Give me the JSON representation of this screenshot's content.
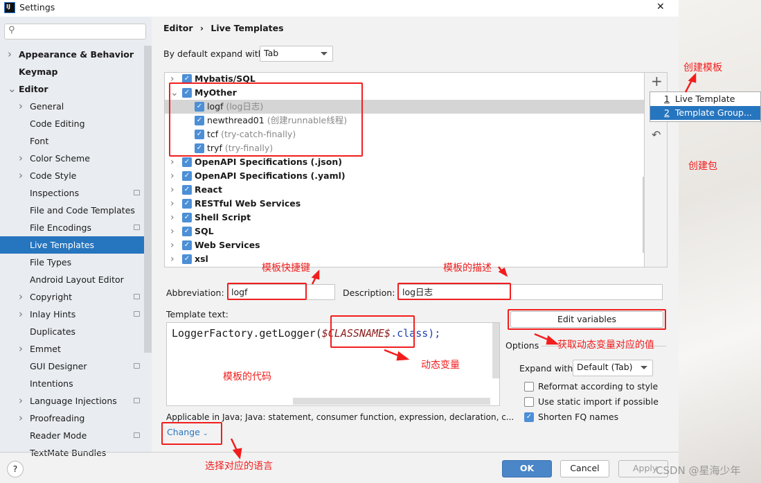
{
  "window": {
    "title": "Settings",
    "close": "✕"
  },
  "search": {
    "placeholder": ""
  },
  "sidebar": {
    "items": [
      {
        "label": "Appearance & Behavior",
        "level": 0,
        "bold": true,
        "chevron": "right"
      },
      {
        "label": "Keymap",
        "level": 0,
        "bold": true
      },
      {
        "label": "Editor",
        "level": 0,
        "bold": true,
        "chevron": "down"
      },
      {
        "label": "General",
        "level": 1,
        "chevron": "right"
      },
      {
        "label": "Code Editing",
        "level": 1
      },
      {
        "label": "Font",
        "level": 1
      },
      {
        "label": "Color Scheme",
        "level": 1,
        "chevron": "right"
      },
      {
        "label": "Code Style",
        "level": 1,
        "chevron": "right"
      },
      {
        "label": "Inspections",
        "level": 1,
        "cfg": true
      },
      {
        "label": "File and Code Templates",
        "level": 1
      },
      {
        "label": "File Encodings",
        "level": 1,
        "cfg": true
      },
      {
        "label": "Live Templates",
        "level": 1,
        "selected": true
      },
      {
        "label": "File Types",
        "level": 1
      },
      {
        "label": "Android Layout Editor",
        "level": 1
      },
      {
        "label": "Copyright",
        "level": 1,
        "chevron": "right",
        "cfg": true
      },
      {
        "label": "Inlay Hints",
        "level": 1,
        "chevron": "right",
        "cfg": true
      },
      {
        "label": "Duplicates",
        "level": 1
      },
      {
        "label": "Emmet",
        "level": 1,
        "chevron": "right"
      },
      {
        "label": "GUI Designer",
        "level": 1,
        "cfg": true
      },
      {
        "label": "Intentions",
        "level": 1
      },
      {
        "label": "Language Injections",
        "level": 1,
        "chevron": "right",
        "cfg": true
      },
      {
        "label": "Proofreading",
        "level": 1,
        "chevron": "right"
      },
      {
        "label": "Reader Mode",
        "level": 1,
        "cfg": true
      },
      {
        "label": "TextMate Bundles",
        "level": 1
      }
    ]
  },
  "breadcrumb": {
    "parent": "Editor",
    "sep": "›",
    "current": "Live Templates"
  },
  "expand_default": {
    "label": "By default expand with",
    "value": "Tab"
  },
  "tree": {
    "rows": [
      {
        "name": "Mybatis/SQL",
        "group": true,
        "chevron": "›"
      },
      {
        "name": "MyOther",
        "group": true,
        "chevron": "⌄"
      },
      {
        "name": "logf",
        "desc": "(log日志)",
        "selected": true
      },
      {
        "name": "newthread01",
        "desc": "(创建runnable线程)"
      },
      {
        "name": "tcf",
        "desc": "(try-catch-finally)"
      },
      {
        "name": "tryf",
        "desc": "(try-finally)"
      },
      {
        "name": "OpenAPI Specifications (.json)",
        "group": true,
        "chevron": "›"
      },
      {
        "name": "OpenAPI Specifications (.yaml)",
        "group": true,
        "chevron": "›"
      },
      {
        "name": "React",
        "group": true,
        "chevron": "›"
      },
      {
        "name": "RESTful Web Services",
        "group": true,
        "chevron": "›"
      },
      {
        "name": "Shell Script",
        "group": true,
        "chevron": "›"
      },
      {
        "name": "SQL",
        "group": true,
        "chevron": "›"
      },
      {
        "name": "Web Services",
        "group": true,
        "chevron": "›"
      },
      {
        "name": "xsl",
        "group": true,
        "chevron": "›"
      }
    ]
  },
  "toolbar": {
    "add": "+",
    "revert": "↶"
  },
  "popup": {
    "items": [
      {
        "num": "1",
        "label": "Live Template"
      },
      {
        "num": "2",
        "label": "Template Group...",
        "selected": true
      }
    ]
  },
  "abbreviation": {
    "label": "Abbreviation:",
    "value": "logf"
  },
  "description": {
    "label": "Description:",
    "value": "log日志"
  },
  "template": {
    "label": "Template text:",
    "code_prefix": "LoggerFactory.getLogger(",
    "code_var": "$CLASSNAME$",
    "code_suffix": ".class);"
  },
  "edit_variables": "Edit variables",
  "options": {
    "title": "Options",
    "expand_label": "Expand with",
    "expand_value": "Default (Tab)",
    "checks": [
      {
        "label": "Reformat according to style",
        "checked": false
      },
      {
        "label": "Use static import if possible",
        "checked": false
      },
      {
        "label": "Shorten FQ names",
        "checked": true
      }
    ]
  },
  "applicable": "Applicable in Java; Java: statement, consumer function, expression, declaration, c...",
  "change": "Change",
  "footer": {
    "help": "?",
    "ok": "OK",
    "cancel": "Cancel",
    "apply": "Apply"
  },
  "watermark": "CSDN @星海少年",
  "annotations": {
    "create_template": "创建模板",
    "create_group": "创建包",
    "shortcut": "模板快捷键",
    "desc": "模板的描述",
    "code": "模板的代码",
    "variable": "动态变量",
    "get_value": "获取动态变量对应的值",
    "language": "选择对应的语言"
  },
  "colors": {
    "accent": "#2675bf",
    "annotation": "#f21d1d"
  }
}
